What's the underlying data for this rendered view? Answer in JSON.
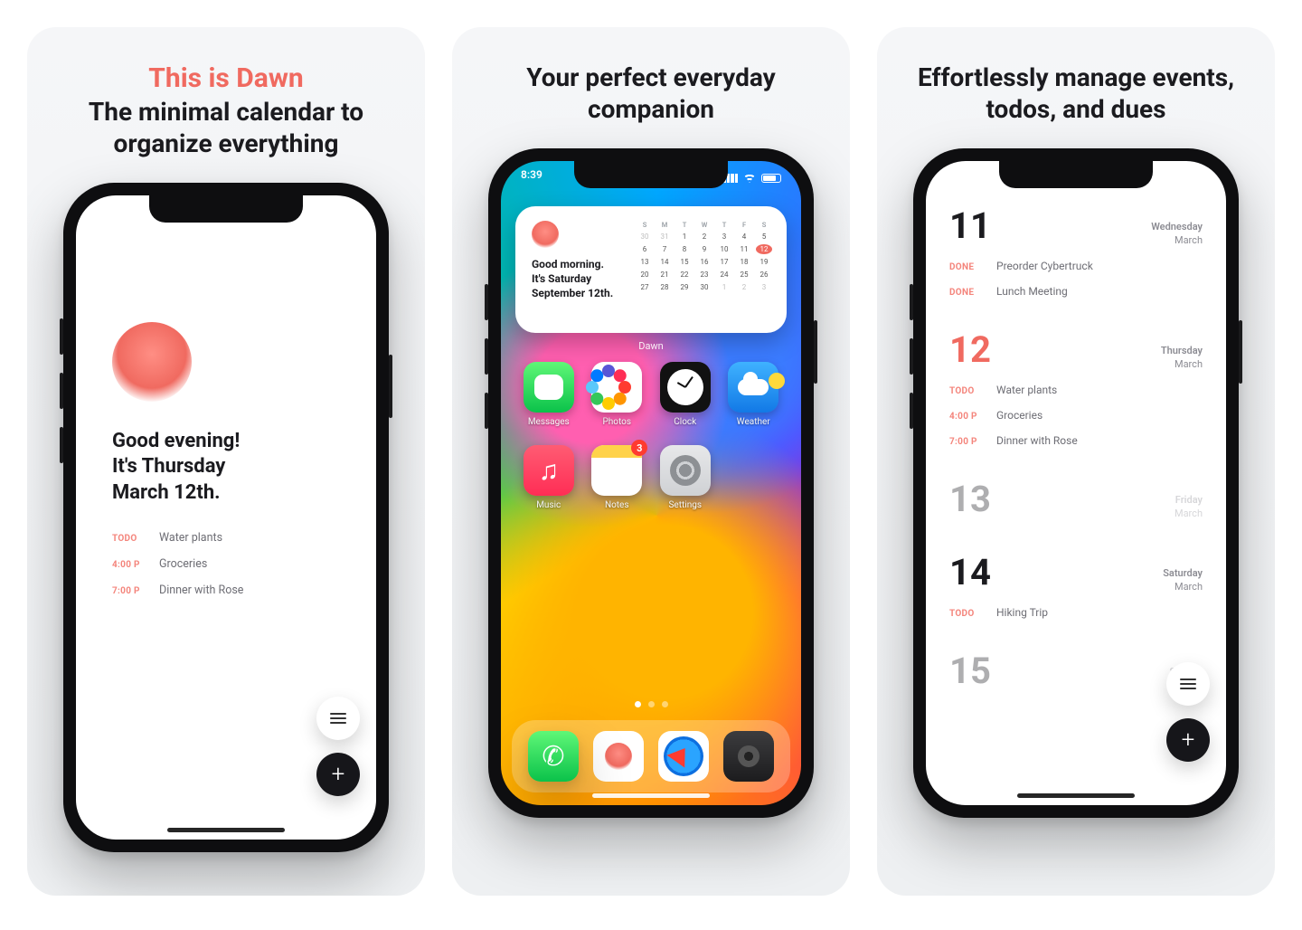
{
  "colors": {
    "accent": "#f06a60",
    "text": "#1b1b1f",
    "muted": "#8c8c93"
  },
  "cards": [
    {
      "title_accent": "This is Dawn",
      "title_rest": "The minimal calendar to organize everything"
    },
    {
      "title_rest": "Your perfect everyday companion"
    },
    {
      "title_rest": "Effortlessly manage events, todos, and dues"
    }
  ],
  "screen1": {
    "greeting_lines": [
      "Good evening!",
      "It's Thursday",
      "March 12th."
    ],
    "events": [
      {
        "tag": "TODO",
        "label": "Water plants"
      },
      {
        "tag": "4:00 P",
        "label": "Groceries"
      },
      {
        "tag": "7:00 P",
        "label": "Dinner with Rose"
      }
    ],
    "menu_icon": "menu-icon",
    "add_icon": "plus-icon"
  },
  "screen2": {
    "status_time": "8:39",
    "widget": {
      "lines": [
        "Good morning.",
        "It's Saturday",
        "September 12th."
      ],
      "label": "Dawn",
      "dow": [
        "S",
        "M",
        "T",
        "W",
        "T",
        "F",
        "S"
      ],
      "days": [
        {
          "n": "30",
          "dim": true
        },
        {
          "n": "31",
          "dim": true
        },
        {
          "n": "1"
        },
        {
          "n": "2"
        },
        {
          "n": "3"
        },
        {
          "n": "4"
        },
        {
          "n": "5"
        },
        {
          "n": "6"
        },
        {
          "n": "7"
        },
        {
          "n": "8"
        },
        {
          "n": "9"
        },
        {
          "n": "10"
        },
        {
          "n": "11"
        },
        {
          "n": "12",
          "today": true
        },
        {
          "n": "13"
        },
        {
          "n": "14"
        },
        {
          "n": "15"
        },
        {
          "n": "16"
        },
        {
          "n": "17"
        },
        {
          "n": "18"
        },
        {
          "n": "19"
        },
        {
          "n": "20"
        },
        {
          "n": "21"
        },
        {
          "n": "22"
        },
        {
          "n": "23"
        },
        {
          "n": "24"
        },
        {
          "n": "25"
        },
        {
          "n": "26"
        },
        {
          "n": "27"
        },
        {
          "n": "28"
        },
        {
          "n": "29"
        },
        {
          "n": "30"
        },
        {
          "n": "1",
          "dim": true
        },
        {
          "n": "2",
          "dim": true
        },
        {
          "n": "3",
          "dim": true
        }
      ]
    },
    "apps": [
      {
        "name": "Messages",
        "cls": "messages",
        "icon": "speech-bubble-icon"
      },
      {
        "name": "Photos",
        "cls": "photos",
        "icon": "photos-icon"
      },
      {
        "name": "Clock",
        "cls": "clock",
        "icon": "clock-icon"
      },
      {
        "name": "Weather",
        "cls": "weather",
        "icon": "weather-icon"
      },
      {
        "name": "Music",
        "cls": "music",
        "icon": "music-note-icon"
      },
      {
        "name": "Notes",
        "cls": "notes",
        "icon": "notes-icon",
        "badge": "3"
      },
      {
        "name": "Settings",
        "cls": "settings",
        "icon": "gear-icon"
      }
    ],
    "dock": [
      {
        "name": "Phone",
        "cls": "phone",
        "icon": "phone-icon"
      },
      {
        "name": "Dawn",
        "cls": "dawn",
        "icon": "dawn-icon"
      },
      {
        "name": "Safari",
        "cls": "safari",
        "icon": "compass-icon"
      },
      {
        "name": "Camera",
        "cls": "camera",
        "icon": "camera-icon"
      }
    ],
    "pager": {
      "count": 3,
      "active": 0
    }
  },
  "screen3": {
    "days": [
      {
        "num": "11",
        "weekday": "Wednesday",
        "month": "March",
        "hl": false,
        "items": [
          {
            "tag": "DONE",
            "label": "Preorder Cybertruck"
          },
          {
            "tag": "DONE",
            "label": "Lunch Meeting"
          }
        ]
      },
      {
        "num": "12",
        "weekday": "Thursday",
        "month": "March",
        "hl": true,
        "items": [
          {
            "tag": "TODO",
            "label": "Water plants"
          },
          {
            "tag": "4:00 P",
            "label": "Groceries"
          },
          {
            "tag": "7:00 P",
            "label": "Dinner with Rose"
          }
        ]
      },
      {
        "num": "13",
        "weekday": "Friday",
        "month": "March",
        "hl": false,
        "faded": true,
        "items": []
      },
      {
        "num": "14",
        "weekday": "Saturday",
        "month": "March",
        "hl": false,
        "items": [
          {
            "tag": "TODO",
            "label": "Hiking Trip"
          }
        ]
      },
      {
        "num": "15",
        "weekday": "Sunday",
        "month": "March",
        "hl": false,
        "faded": true,
        "items": []
      }
    ]
  }
}
